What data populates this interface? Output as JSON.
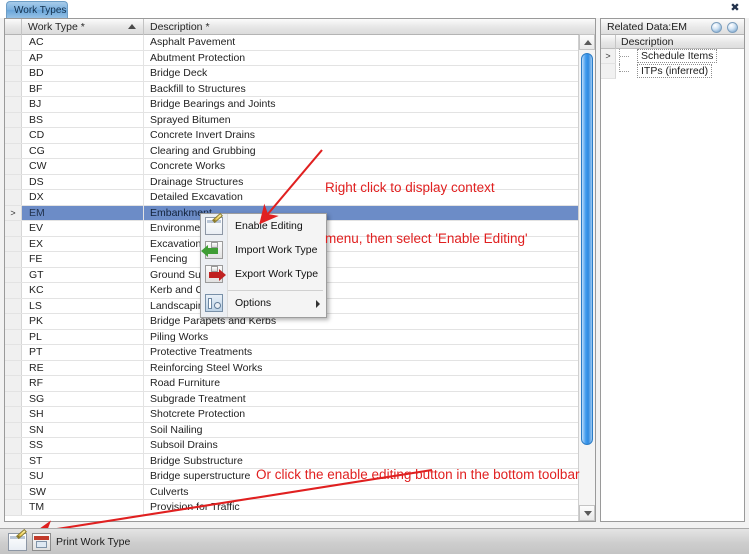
{
  "window": {
    "tab_label": "Work Types",
    "close_icon": "close-icon"
  },
  "grid": {
    "columns": [
      {
        "key": "work_type",
        "label": "Work Type *",
        "sorted": "asc"
      },
      {
        "key": "description",
        "label": "Description *"
      }
    ],
    "selected_code": "EM",
    "row_marker": ">",
    "rows": [
      {
        "code": "AC",
        "description": "Asphalt Pavement"
      },
      {
        "code": "AP",
        "description": "Abutment Protection"
      },
      {
        "code": "BD",
        "description": "Bridge Deck"
      },
      {
        "code": "BF",
        "description": "Backfill to Structures"
      },
      {
        "code": "BJ",
        "description": "Bridge Bearings and Joints"
      },
      {
        "code": "BS",
        "description": "Sprayed Bitumen"
      },
      {
        "code": "CD",
        "description": "Concrete Invert Drains"
      },
      {
        "code": "CG",
        "description": "Clearing and Grubbing"
      },
      {
        "code": "CW",
        "description": "Concrete Works"
      },
      {
        "code": "DS",
        "description": "Drainage Structures"
      },
      {
        "code": "DX",
        "description": "Detailed Excavation"
      },
      {
        "code": "EM",
        "description": "Embankment"
      },
      {
        "code": "EV",
        "description": "Environmental"
      },
      {
        "code": "EX",
        "description": "Excavation"
      },
      {
        "code": "FE",
        "description": "Fencing"
      },
      {
        "code": "GT",
        "description": "Ground Surface"
      },
      {
        "code": "KC",
        "description": "Kerb and Chan"
      },
      {
        "code": "LS",
        "description": "Landscaping"
      },
      {
        "code": "PK",
        "description": "Bridge Parapets and Kerbs"
      },
      {
        "code": "PL",
        "description": "Piling Works"
      },
      {
        "code": "PT",
        "description": "Protective Treatments"
      },
      {
        "code": "RE",
        "description": "Reinforcing Steel Works"
      },
      {
        "code": "RF",
        "description": "Road Furniture"
      },
      {
        "code": "SG",
        "description": "Subgrade Treatment"
      },
      {
        "code": "SH",
        "description": "Shotcrete Protection"
      },
      {
        "code": "SN",
        "description": "Soil Nailing"
      },
      {
        "code": "SS",
        "description": "Subsoil Drains"
      },
      {
        "code": "ST",
        "description": "Bridge Substructure"
      },
      {
        "code": "SU",
        "description": "Bridge superstructure"
      },
      {
        "code": "SW",
        "description": "Culverts"
      },
      {
        "code": "TM",
        "description": "Provision for Traffic"
      }
    ]
  },
  "related_panel": {
    "title": "Related Data:EM",
    "column_header": "Description",
    "row_marker": ">",
    "items": [
      {
        "label": "Schedule Items"
      },
      {
        "label": "ITPs (inferred)"
      }
    ]
  },
  "context_menu": {
    "items": [
      {
        "label": "Enable Editing",
        "icon": "edit-icon",
        "submenu": false
      },
      {
        "label": "Import Work Type",
        "icon": "import-arrow-icon",
        "submenu": false
      },
      {
        "label": "Export Work Type",
        "icon": "export-arrow-icon",
        "submenu": false
      },
      {
        "label": "Options",
        "icon": "options-icon",
        "submenu": true
      }
    ]
  },
  "bottom_toolbar": {
    "enable_editing_icon": "edit-icon",
    "print_icon": "print-icon",
    "label": "Print Work Type"
  },
  "annotations": {
    "color": "#e02020",
    "callout_1_line_1": "Right click to display context",
    "callout_1_line_2": "menu, then select 'Enable Editing'",
    "callout_2": "Or click the enable editing button in the bottom toolbar"
  }
}
